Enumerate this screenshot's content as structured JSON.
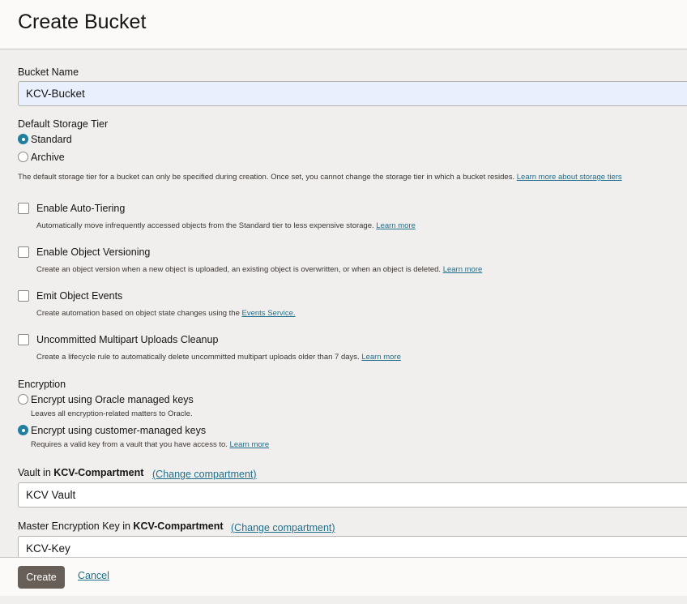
{
  "header": {
    "title": "Create Bucket"
  },
  "bucket_name": {
    "label": "Bucket Name",
    "value": "KCV-Bucket"
  },
  "storage_tier": {
    "label": "Default Storage Tier",
    "options": [
      {
        "label": "Standard",
        "checked": true
      },
      {
        "label": "Archive",
        "checked": false
      }
    ],
    "help": "The default storage tier for a bucket can only be specified during creation. Once set, you cannot change the storage tier in which a bucket resides.",
    "help_link": "Learn more about storage tiers"
  },
  "options": [
    {
      "label": "Enable Auto-Tiering",
      "help": "Automatically move infrequently accessed objects from the Standard tier to less expensive storage.",
      "link": "Learn more",
      "checked": false
    },
    {
      "label": "Enable Object Versioning",
      "help": "Create an object version when a new object is uploaded, an existing object is overwritten, or when an object is deleted.",
      "link": "Learn more",
      "checked": false
    },
    {
      "label": "Emit Object Events",
      "help": "Create automation based on object state changes using the",
      "link": "Events Service.",
      "checked": false
    },
    {
      "label": "Uncommitted Multipart Uploads Cleanup",
      "help": "Create a lifecycle rule to automatically delete uncommitted multipart uploads older than 7 days.",
      "link": "Learn more",
      "checked": false
    }
  ],
  "encryption": {
    "label": "Encryption",
    "options": [
      {
        "label": "Encrypt using Oracle managed keys",
        "help": "Leaves all encryption-related matters to Oracle.",
        "checked": false
      },
      {
        "label": "Encrypt using customer-managed keys",
        "help": "Requires a valid key from a vault that you have access to.",
        "link": "Learn more",
        "checked": true
      }
    ]
  },
  "vault": {
    "label_prefix": "Vault in ",
    "compartment": "KCV-Compartment",
    "change_link": "(Change compartment)",
    "value": "KCV Vault"
  },
  "master_key": {
    "label_prefix": "Master Encryption Key in ",
    "compartment": "KCV-Compartment",
    "change_link": "(Change compartment)",
    "value": "KCV-Key"
  },
  "footer": {
    "create_label": "Create",
    "cancel_label": "Cancel"
  },
  "colors": {
    "accent": "#227e9e",
    "link": "#1f6f8b",
    "primary_button": "#665e57",
    "autofill": "#e8f0fe"
  }
}
